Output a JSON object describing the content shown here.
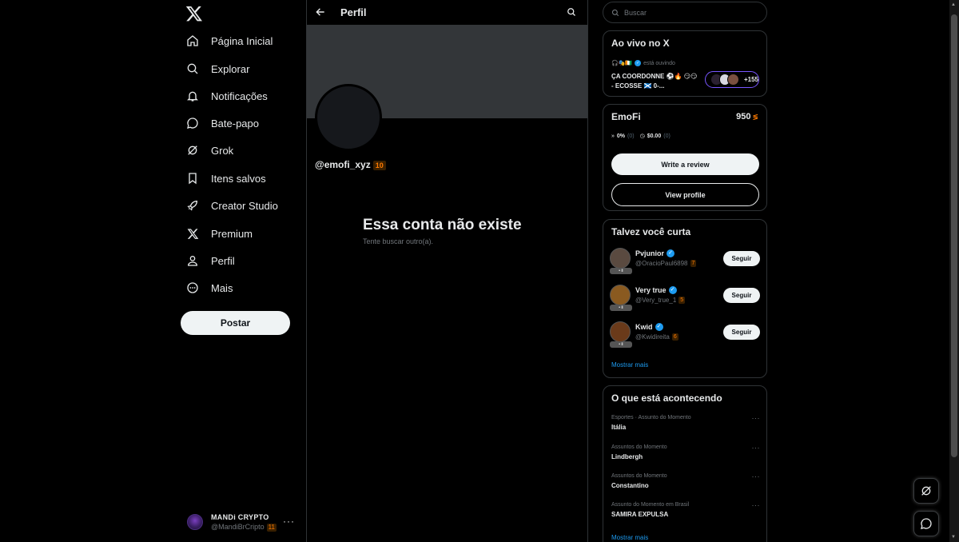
{
  "nav": {
    "items": [
      {
        "label": "Página Inicial",
        "icon": "home-icon"
      },
      {
        "label": "Explorar",
        "icon": "search-icon"
      },
      {
        "label": "Notificações",
        "icon": "bell-icon"
      },
      {
        "label": "Bate-papo",
        "icon": "chat-icon"
      },
      {
        "label": "Grok",
        "icon": "grok-icon"
      },
      {
        "label": "Itens salvos",
        "icon": "bookmark-icon"
      },
      {
        "label": "Creator Studio",
        "icon": "rocket-icon"
      },
      {
        "label": "Premium",
        "icon": "x-icon"
      },
      {
        "label": "Perfil",
        "icon": "person-icon"
      },
      {
        "label": "Mais",
        "icon": "more-circle-icon"
      }
    ],
    "post_label": "Postar"
  },
  "account": {
    "name": "MANDi CRYPTO",
    "handle": "@MandiBrCripto",
    "badge": "11"
  },
  "main": {
    "title": "Perfil",
    "handle": "@emofi_xyz",
    "handle_badge": "10",
    "not_exist_title": "Essa conta não existe",
    "not_exist_sub": "Tente buscar outro(a)."
  },
  "search": {
    "placeholder": "Buscar"
  },
  "live": {
    "title": "Ao vivo no X",
    "listening_emoji": "🎧🎭🇨🇮",
    "listening_text": "está ouvindo",
    "space_title": "ÇA COORDONNE ⚽🔥 😏😏 - ECOSSE 🏴󠁧󠁢󠁳󠁣󠁴󠁿 0-...",
    "count": "+155"
  },
  "emofi": {
    "title": "EmoFi",
    "score": "950",
    "pct": "0%",
    "pct_count": "(0)",
    "amount": "$0.00",
    "amount_count": "(0)",
    "review_label": "Write a review",
    "profile_label": "View profile"
  },
  "who_to_follow": {
    "title": "Talvez você curta",
    "users": [
      {
        "name": "Pvjunior",
        "handle": "@OracioPaul6898",
        "badge": "7",
        "follow": "Seguir",
        "avatar_color": "#5a4a40"
      },
      {
        "name": "Very true",
        "handle": "@Very_true_1",
        "badge": "5",
        "follow": "Seguir",
        "avatar_color": "#8a5a20"
      },
      {
        "name": "Kwid",
        "handle": "@Kwidireita",
        "badge": "6",
        "follow": "Seguir",
        "avatar_color": "#6a3a1a"
      }
    ],
    "show_more": "Mostrar mais"
  },
  "trends": {
    "title": "O que está acontecendo",
    "items": [
      {
        "context": "Esportes · Assunto do Momento",
        "name": "Itália"
      },
      {
        "context": "Assuntos do Momento",
        "name": "Lindbergh"
      },
      {
        "context": "Assuntos do Momento",
        "name": "Constantino"
      },
      {
        "context": "Assunto do Momento em Brasil",
        "name": "SAMIRA EXPULSA"
      }
    ],
    "show_more": "Mostrar mais"
  },
  "colors": {
    "accent": "#1d9bf0",
    "badge": "#ff7a00",
    "border": "#2f3336"
  }
}
